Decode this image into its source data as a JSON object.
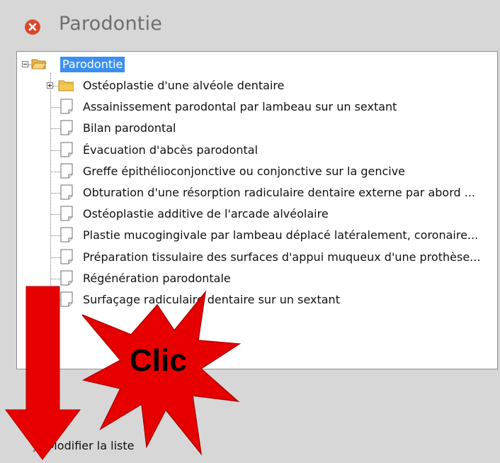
{
  "window": {
    "title": "Parodontie",
    "close_icon": "close-icon",
    "accent_color": "#d9472b"
  },
  "tree": {
    "root": {
      "label": "Parodontie",
      "icon": "folder-open-icon",
      "expander": "minus",
      "selected": true
    },
    "items": [
      {
        "label": "Ostéoplastie d'une alvéole dentaire",
        "icon": "folder-icon",
        "expander": "plus"
      },
      {
        "label": "Assainissement parodontal par lambeau sur un sextant",
        "icon": "document-icon"
      },
      {
        "label": "Bilan parodontal",
        "icon": "document-icon"
      },
      {
        "label": "Évacuation d'abcès parodontal",
        "icon": "document-icon"
      },
      {
        "label": "Greffe épithélioconjonctive ou conjonctive sur la gencive",
        "icon": "document-icon"
      },
      {
        "label": "Obturation d'une résorption radiculaire dentaire externe par abord ...",
        "icon": "document-icon"
      },
      {
        "label": "Ostéoplastie additive de l'arcade alvéolaire",
        "icon": "document-icon"
      },
      {
        "label": "Plastie mucogingivale par lambeau déplacé latéralement, coronaire...",
        "icon": "document-icon"
      },
      {
        "label": "Préparation tissulaire des surfaces d'appui muqueux d'une prothèse...",
        "icon": "document-icon"
      },
      {
        "label": "Régénération parodontale",
        "icon": "document-icon"
      },
      {
        "label": "Surfaçage radiculaire dentaire sur un sextant",
        "icon": "document-icon"
      }
    ],
    "selection_color": "#3b8ff2"
  },
  "footer": {
    "modify_label": "Modifier la liste",
    "modify_icon": "tools-icon"
  },
  "annotation": {
    "text": "Clic",
    "star_color": "#e60000",
    "arrow_color": "#e60000"
  }
}
